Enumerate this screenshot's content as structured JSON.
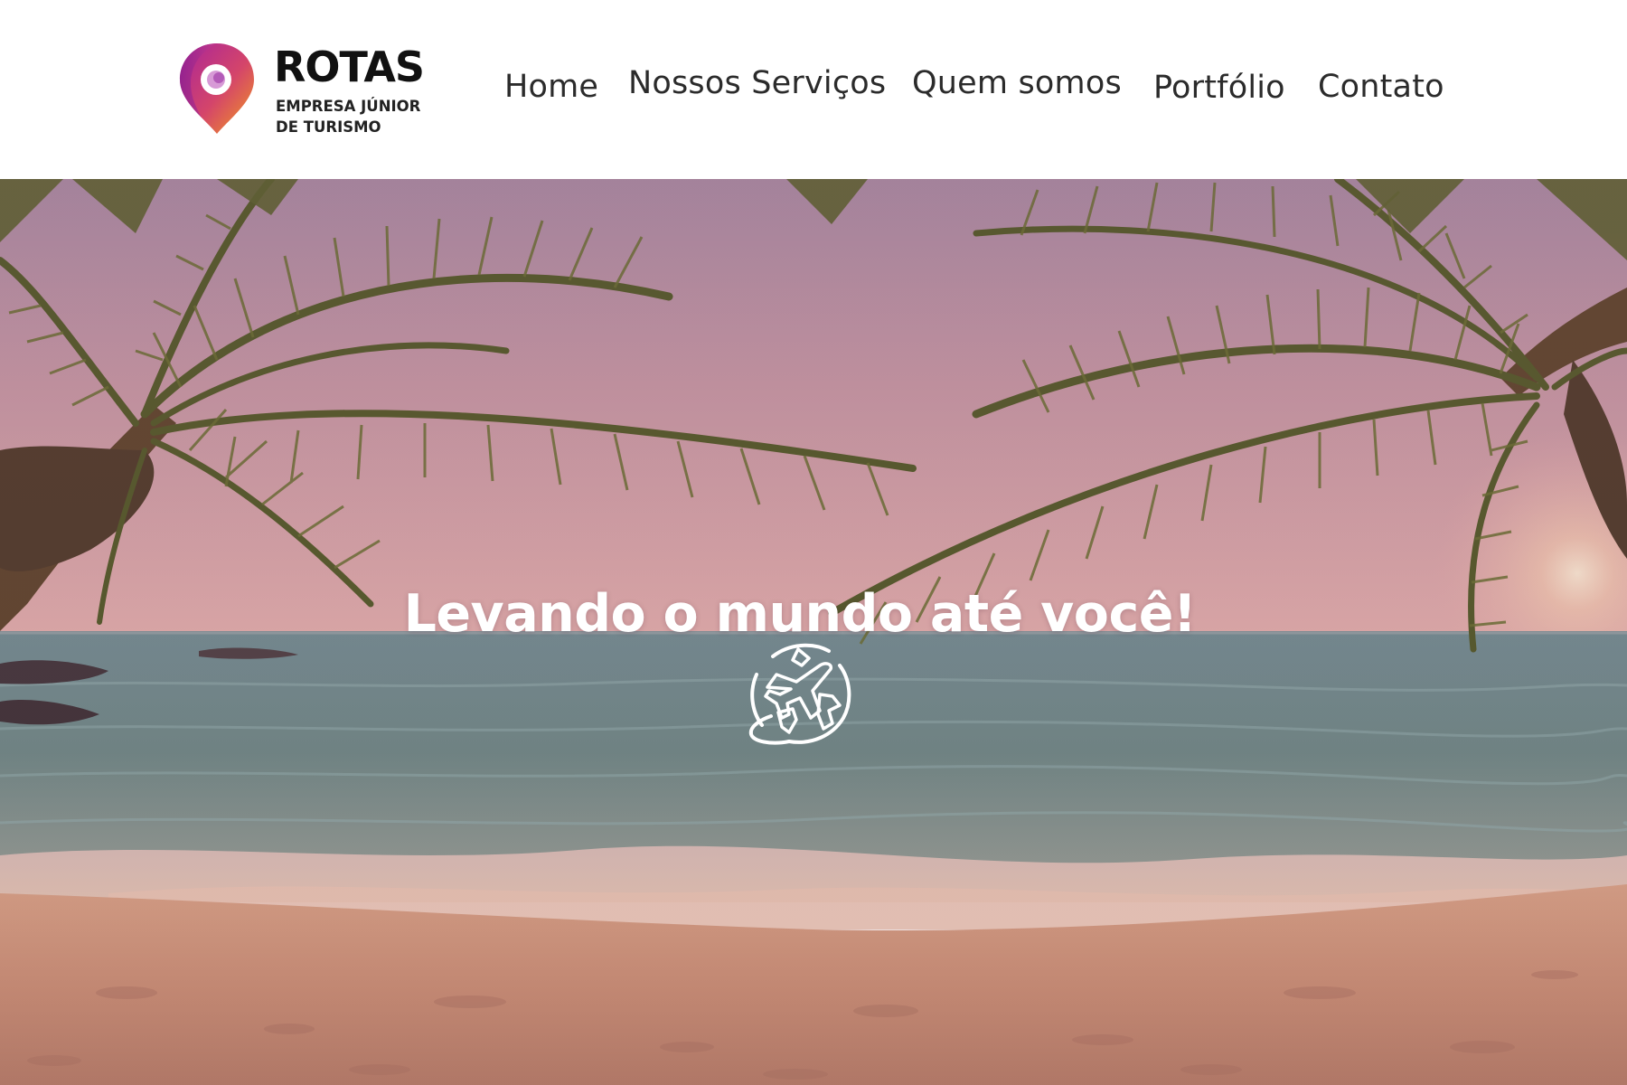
{
  "brand": {
    "name": "ROTAS",
    "tagline_line1": "EMPRESA JÚNIOR",
    "tagline_line2": "DE TURISMO",
    "colors": {
      "pin_gradient_start": "#b0269c",
      "pin_gradient_end": "#f29a1c",
      "pin_inner": "#e7b6e0"
    }
  },
  "nav": {
    "items": [
      {
        "label": "Home"
      },
      {
        "label": "Nossos Serviços"
      },
      {
        "label": "Quem somos"
      },
      {
        "label": "Portfólio"
      },
      {
        "label": "Contato"
      }
    ]
  },
  "hero": {
    "title": "Levando o mundo até você!",
    "icon": "globe-airplane-icon"
  }
}
